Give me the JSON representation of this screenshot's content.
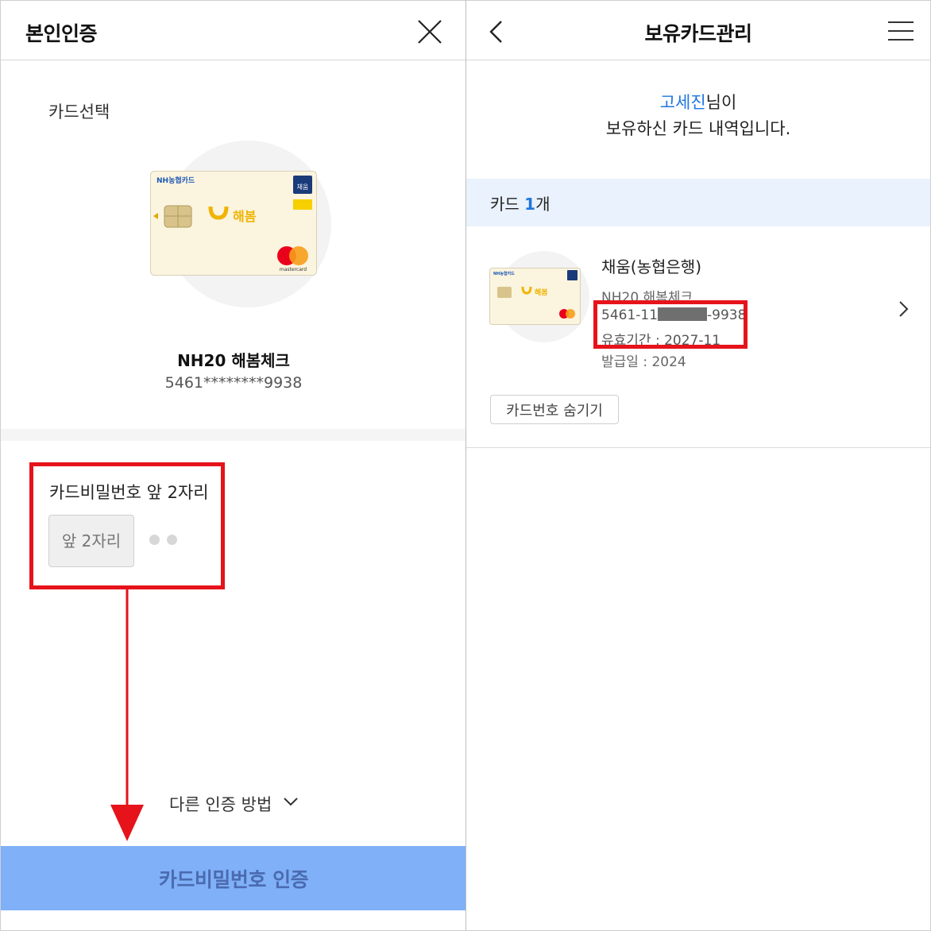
{
  "left": {
    "title": "본인인증",
    "section_label": "카드선택",
    "card": {
      "name": "NH20 해봄체크",
      "number": "5461********9938",
      "brand": "NH농협카드",
      "badge": "채움",
      "logo_text": "해봄",
      "network": "mastercard"
    },
    "password": {
      "label": "카드비밀번호 앞 2자리",
      "placeholder": "앞 2자리"
    },
    "other_auth": "다른 인증 방법",
    "submit": "카드비밀번호 인증"
  },
  "right": {
    "title": "보유카드관리",
    "greeting": {
      "name": "고세진",
      "suffix": "님이",
      "line2": "보유하신 카드 내역입니다."
    },
    "count": {
      "label": "카드",
      "number": "1",
      "unit": "개"
    },
    "card": {
      "title": "채움(농협은행)",
      "product": "NH20 해봄체크",
      "number_prefix": "5461-11",
      "number_suffix": "-9938",
      "expiry": "유효기간 : 2027-11",
      "issued": "발급일 : 2024"
    },
    "hide_button": "카드번호 숨기기"
  },
  "colors": {
    "accent_blue": "#1f76e0",
    "submit_bg": "#7fb0f8",
    "highlight_red": "#e6131b",
    "count_bar_bg": "#eaf2fd"
  }
}
